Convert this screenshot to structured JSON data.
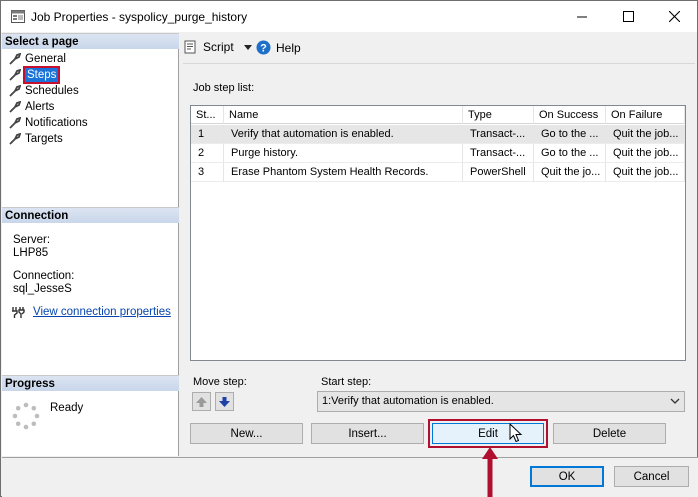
{
  "window": {
    "title": "Job Properties - syspolicy_purge_history",
    "minimize": "—",
    "maximize": "☐",
    "close": "✕"
  },
  "left": {
    "select_page_header": "Select a page",
    "pages": [
      {
        "label": "General",
        "selected": false
      },
      {
        "label": "Steps",
        "selected": true
      },
      {
        "label": "Schedules",
        "selected": false
      },
      {
        "label": "Alerts",
        "selected": false
      },
      {
        "label": "Notifications",
        "selected": false
      },
      {
        "label": "Targets",
        "selected": false
      }
    ],
    "connection_header": "Connection",
    "server_label": "Server:",
    "server_value": "LHP85",
    "connection_label": "Connection:",
    "connection_value": "sql_JesseS",
    "view_conn_link": "View connection properties",
    "progress_header": "Progress",
    "progress_status": "Ready"
  },
  "toolbar": {
    "script_label": "Script",
    "help_label": "Help"
  },
  "steps": {
    "list_label": "Job step list:",
    "columns": [
      "St...",
      "Name",
      "Type",
      "On Success",
      "On Failure"
    ],
    "rows": [
      [
        "1",
        "Verify that automation is enabled.",
        "Transact-...",
        "Go to the ...",
        "Quit the job..."
      ],
      [
        "2",
        "Purge history.",
        "Transact-...",
        "Go to the ...",
        "Quit the job..."
      ],
      [
        "3",
        "Erase Phantom System Health Records.",
        "PowerShell",
        "Quit the jo...",
        "Quit the job..."
      ]
    ],
    "move_step_label": "Move step:",
    "start_step_label": "Start step:",
    "start_step_value": "1:Verify that automation is enabled.",
    "new_label": "New...",
    "insert_label": "Insert...",
    "edit_label": "Edit",
    "delete_label": "Delete"
  },
  "footer": {
    "ok_label": "OK",
    "cancel_label": "Cancel"
  },
  "colors": {
    "selection": "#1a73d9",
    "highlight_box": "#b0102e",
    "link": "#0645ad"
  }
}
